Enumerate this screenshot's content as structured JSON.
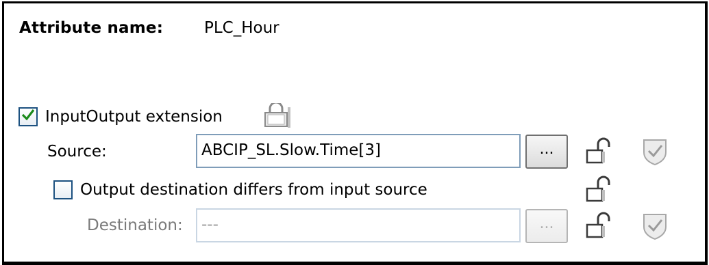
{
  "attribute": {
    "name_label": "Attribute name:",
    "name_value": "PLC_Hour"
  },
  "io_extension": {
    "label": "InputOutput extension",
    "checked": true,
    "lock_icon": "lock-icon"
  },
  "source": {
    "label": "Source:",
    "value": "ABCIP_SL.Slow.Time[3]",
    "browse_label": "..."
  },
  "output_differs": {
    "label": "Output destination differs from input source",
    "checked": false
  },
  "destination": {
    "label": "Destination:",
    "value": "---",
    "browse_label": "..."
  },
  "colors": {
    "checkbox_border": "#1c5180",
    "checkmark": "#1a8a1a",
    "textbox_border": "#7f9db9",
    "disabled_text": "#9a9a9a"
  }
}
